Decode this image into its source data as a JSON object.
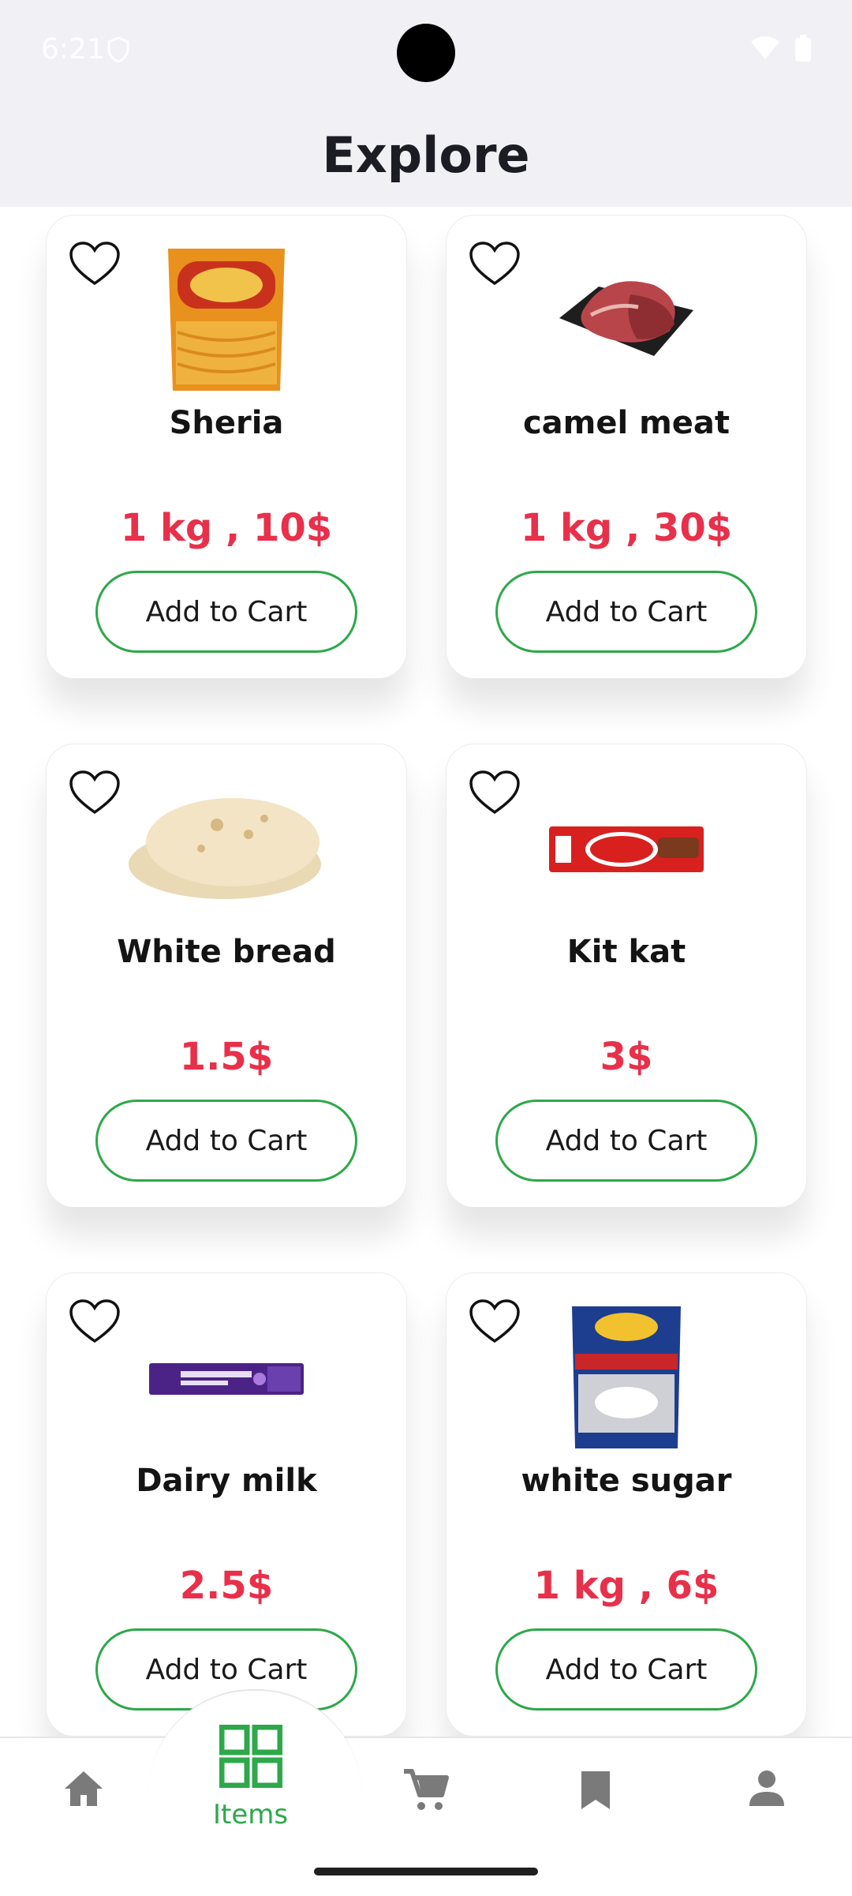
{
  "status": {
    "time": "6:21"
  },
  "header": {
    "title": "Explore"
  },
  "products": [
    {
      "name": "Sheria",
      "price": "1 kg ,  10$",
      "button": "Add to Cart",
      "image": "vermicelli-bag"
    },
    {
      "name": "camel meat",
      "price": "1 kg ,  30$",
      "button": "Add to Cart",
      "image": "meat-tray"
    },
    {
      "name": "White bread",
      "price": "1.5$",
      "button": "Add to Cart",
      "image": "pita-bread"
    },
    {
      "name": "Kit kat",
      "price": "3$",
      "button": "Add to Cart",
      "image": "kitkat-bar"
    },
    {
      "name": "Dairy milk",
      "price": "2.5$",
      "button": "Add to Cart",
      "image": "chocolate-bar"
    },
    {
      "name": "white sugar",
      "price": "1 kg ,  6$",
      "button": "Add to Cart",
      "image": "sugar-bag"
    }
  ],
  "nav": {
    "items": [
      {
        "icon": "home-icon"
      },
      {
        "icon": "grid-icon",
        "label": "Items",
        "active": true
      },
      {
        "icon": "cart-icon"
      },
      {
        "icon": "bookmark-icon"
      },
      {
        "icon": "person-icon"
      }
    ]
  },
  "colors": {
    "accent": "#2da84a",
    "price": "#e8304a",
    "header_bg": "#f1f0f5"
  }
}
